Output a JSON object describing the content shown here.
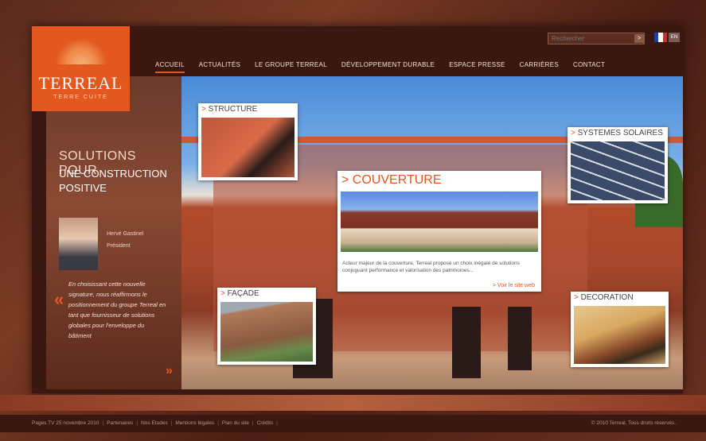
{
  "logo": {
    "brand": "TERREAL",
    "sub": "TERRE CUITE"
  },
  "search": {
    "placeholder": "Rechercher",
    "go_label": ">"
  },
  "lang": {
    "en_label": "EN",
    "flag_colors": [
      "#1f3fa0",
      "#ffffff",
      "#d62a2a"
    ]
  },
  "nav": [
    {
      "label": "ACCUEIL",
      "active": true
    },
    {
      "label": "ACTUALITÉS"
    },
    {
      "label": "LE GROUPE TERREAL"
    },
    {
      "label": "DÉVELOPPEMENT DURABLE"
    },
    {
      "label": "ESPACE PRESSE"
    },
    {
      "label": "CARRIÈRES"
    },
    {
      "label": "CONTACT"
    }
  ],
  "left": {
    "title1": "SOLUTIONS POUR",
    "title2": "UNE CONSTRUCTION POSITIVE",
    "person_name": "Hervé Gastinel",
    "person_role": "Président",
    "quote_open": "«",
    "quote_close": "»",
    "quote": "En choisissant cette nouvelle signature, nous réaffirmons le positionnement du groupe Terreal en tant que fournisseur de solutions globales pour l'enveloppe du bâtiment"
  },
  "cards": {
    "structure": "STRUCTURE",
    "solaires": "SYSTEMES SOLAIRES",
    "couverture": "COUVERTURE",
    "couverture_desc": "Acteur majeur de la couverture, Terreal propose un choix inégalé de solutions conjuguant performance et valorisation des patrimoines...",
    "couverture_link": "> Voir le site web",
    "facade": "FAÇADE",
    "decoration": "DECORATION",
    "arrow": ">"
  },
  "footer": {
    "links": [
      "Pages TV 25 novembre 2010",
      "Partenaires",
      "Nos Etudes",
      "Mentions légales",
      "Plan du site",
      "Crédits"
    ],
    "copyright": "© 2010 Terreal. Tous droits réservés."
  },
  "colors": {
    "accent": "#e2581f",
    "bg": "#3a1710"
  }
}
